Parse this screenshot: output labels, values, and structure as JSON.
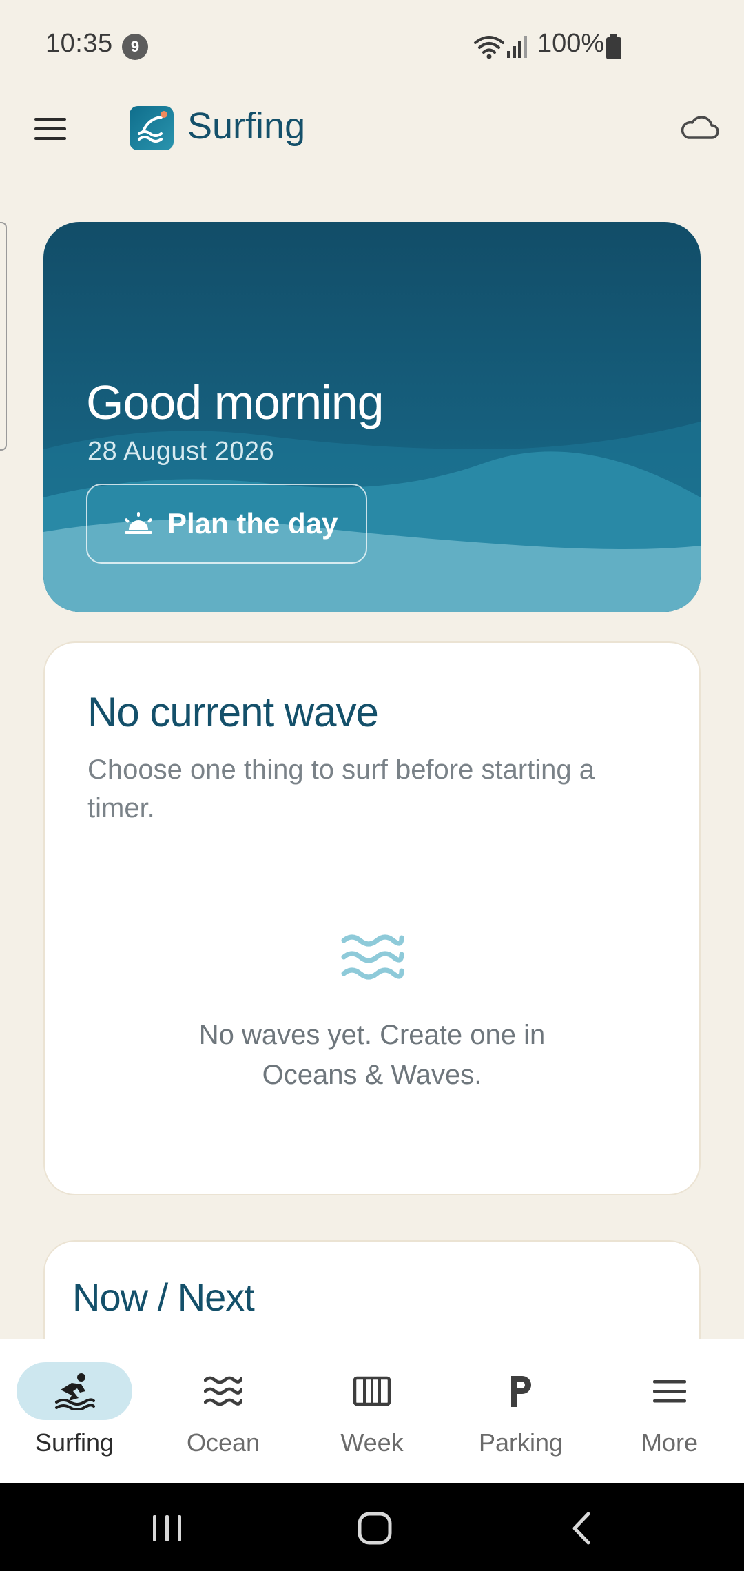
{
  "status_bar": {
    "time": "10:35",
    "notification_count": "9",
    "battery": "100%"
  },
  "app_bar": {
    "title": "Surfing"
  },
  "hero": {
    "greeting": "Good morning",
    "date": "28 August 2026",
    "plan_button_label": "Plan the day"
  },
  "current_wave": {
    "title": "No current wave",
    "description": "Choose one thing to surf before starting a timer.",
    "empty_text": "No waves yet. Create one in Oceans & Waves."
  },
  "now_next": {
    "title": "Now / Next"
  },
  "bottom_nav": {
    "items": [
      {
        "label": "Surfing",
        "icon": "surfer-icon",
        "active": true
      },
      {
        "label": "Ocean",
        "icon": "waves-icon",
        "active": false
      },
      {
        "label": "Week",
        "icon": "week-columns-icon",
        "active": false
      },
      {
        "label": "Parking",
        "icon": "parking-icon",
        "active": false
      },
      {
        "label": "More",
        "icon": "menu-icon",
        "active": false
      }
    ]
  },
  "colors": {
    "background": "#F4F0E7",
    "brand_dark": "#14506A",
    "hero_top": "#124D68",
    "active_pill": "#CDE7EF"
  }
}
